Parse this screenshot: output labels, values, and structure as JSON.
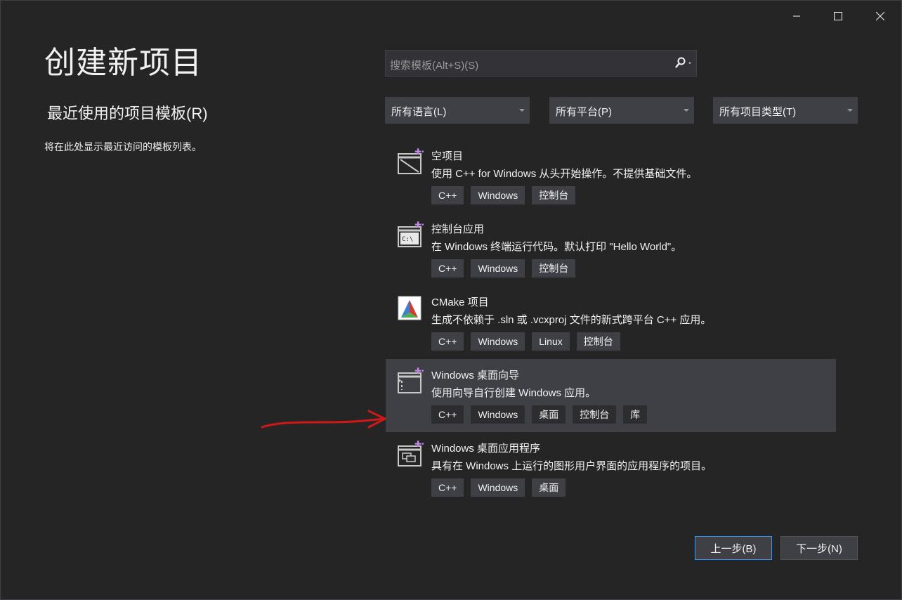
{
  "window": {
    "title": "创建新项目",
    "controls": [
      "minimize-icon",
      "maximize-icon",
      "close-icon"
    ]
  },
  "recent": {
    "heading": "最近使用的项目模板(R)",
    "empty_text": "将在此处显示最近访问的模板列表。"
  },
  "search": {
    "placeholder": "搜索模板(Alt+S)(S)",
    "icon": "search-icon"
  },
  "filters": [
    {
      "label": "所有语言(L)"
    },
    {
      "label": "所有平台(P)"
    },
    {
      "label": "所有项目类型(T)"
    }
  ],
  "templates": [
    {
      "name": "空项目",
      "desc": "使用 C++ for Windows 从头开始操作。不提供基础文件。",
      "tags": [
        "C++",
        "Windows",
        "控制台"
      ],
      "icon": "empty-project-icon"
    },
    {
      "name": "控制台应用",
      "desc": "在 Windows 终端运行代码。默认打印 \"Hello World\"。",
      "tags": [
        "C++",
        "Windows",
        "控制台"
      ],
      "icon": "console-app-icon"
    },
    {
      "name": "CMake 项目",
      "desc": "生成不依赖于 .sln 或 .vcxproj 文件的新式跨平台 C++ 应用。",
      "tags": [
        "C++",
        "Windows",
        "Linux",
        "控制台"
      ],
      "icon": "cmake-icon"
    },
    {
      "name": "Windows 桌面向导",
      "desc": "使用向导自行创建 Windows 应用。",
      "tags": [
        "C++",
        "Windows",
        "桌面",
        "控制台",
        "库"
      ],
      "icon": "desktop-wizard-icon",
      "selected": true
    },
    {
      "name": "Windows 桌面应用程序",
      "desc": "具有在 Windows 上运行的图形用户界面的应用程序的项目。",
      "tags": [
        "C++",
        "Windows",
        "桌面"
      ],
      "icon": "desktop-app-icon"
    }
  ],
  "buttons": {
    "back": "上一步(B)",
    "next": "下一步(N)"
  },
  "colors": {
    "background": "#252526",
    "selected_item": "#3f3f46",
    "accent_border": "#3399ff",
    "annotation_arrow": "#d01818",
    "template_sparkle": "#c586e8"
  }
}
